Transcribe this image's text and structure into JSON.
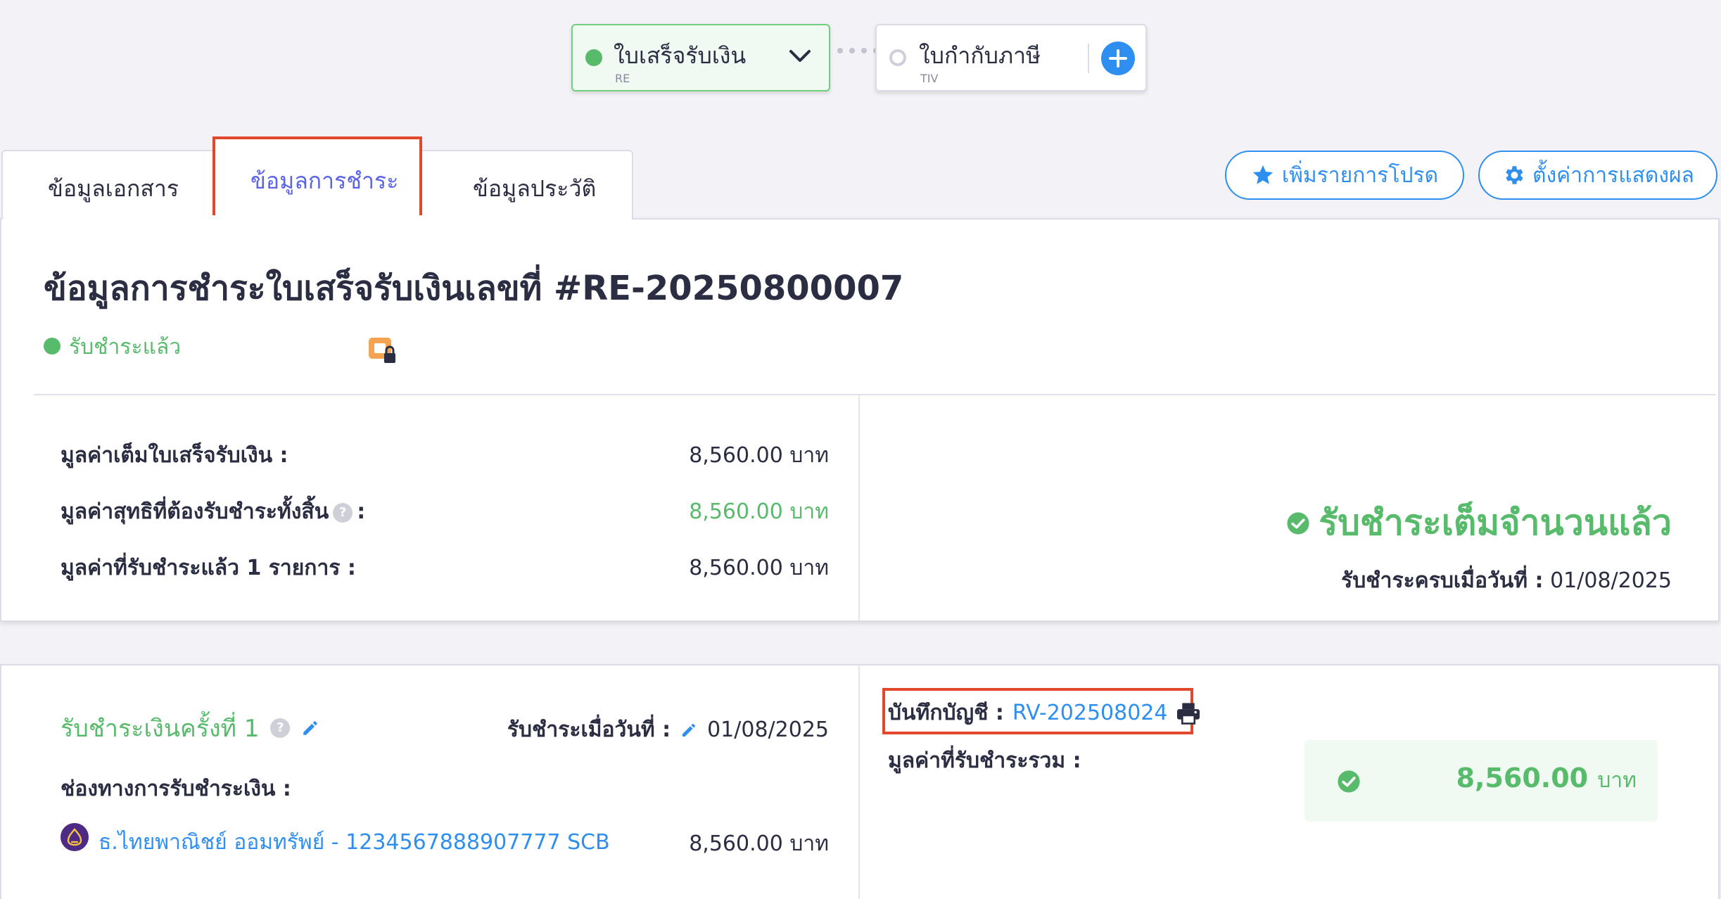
{
  "doc_flow": {
    "current": {
      "title": "ใบเสร็จรับเงิน",
      "code": "RE"
    },
    "next": {
      "title": "ใบกำกับภาษี",
      "code": "TIV"
    }
  },
  "tabs": [
    {
      "label": "ข้อมูลเอกสาร"
    },
    {
      "label": "ข้อมูลการชำระ",
      "active": true
    },
    {
      "label": "ข้อมูลประวัติ"
    }
  ],
  "actions": {
    "favorite_label": "เพิ่มรายการโปรด",
    "display_settings_label": "ตั้งค่าการแสดงผล"
  },
  "summary": {
    "title": "ข้อมูลการชำระใบเสร็จรับเงินเลขที่ #RE-20250800007",
    "status": "รับชำระแล้ว",
    "rows": [
      {
        "label": "มูลค่าเต็มใบเสร็จรับเงิน :",
        "value": "8,560.00 บาท"
      },
      {
        "label": "มูลค่าสุทธิที่ต้องรับชำระทั้งสิ้น",
        "suffix": ":",
        "value": "8,560.00 บาท"
      },
      {
        "label": "มูลค่าที่รับชำระแล้ว 1 รายการ :",
        "value": "8,560.00 บาท"
      }
    ],
    "paid_full_text": "รับชำระเต็มจำนวนแล้ว",
    "paid_date_label": "รับชำระครบเมื่อวันที่ :",
    "paid_date": "01/08/2025"
  },
  "payment": {
    "title": "รับชำระเงินครั้งที่ 1",
    "date_label": "รับชำระเมื่อวันที่ :",
    "date": "01/08/2025",
    "channel_label": "ช่องทางการรับชำระเงิน :",
    "bank_text": "ธ.ไทยพาณิชย์ ออมทรัพย์ - 1234567888907777 SCB",
    "bank_amount": "8,560.00 บาท",
    "account_label": "บันทึกบัญชี :",
    "account_number": "RV-202508024",
    "total_label": "มูลค่าที่รับชำระรวม :",
    "total_amount": "8,560.00",
    "total_unit": "บาท"
  },
  "colors": {
    "accent_blue": "#2e8ff0",
    "success_green": "#58bb6b",
    "tab_active": "#5b63e6",
    "highlight_red": "#e2482e"
  }
}
